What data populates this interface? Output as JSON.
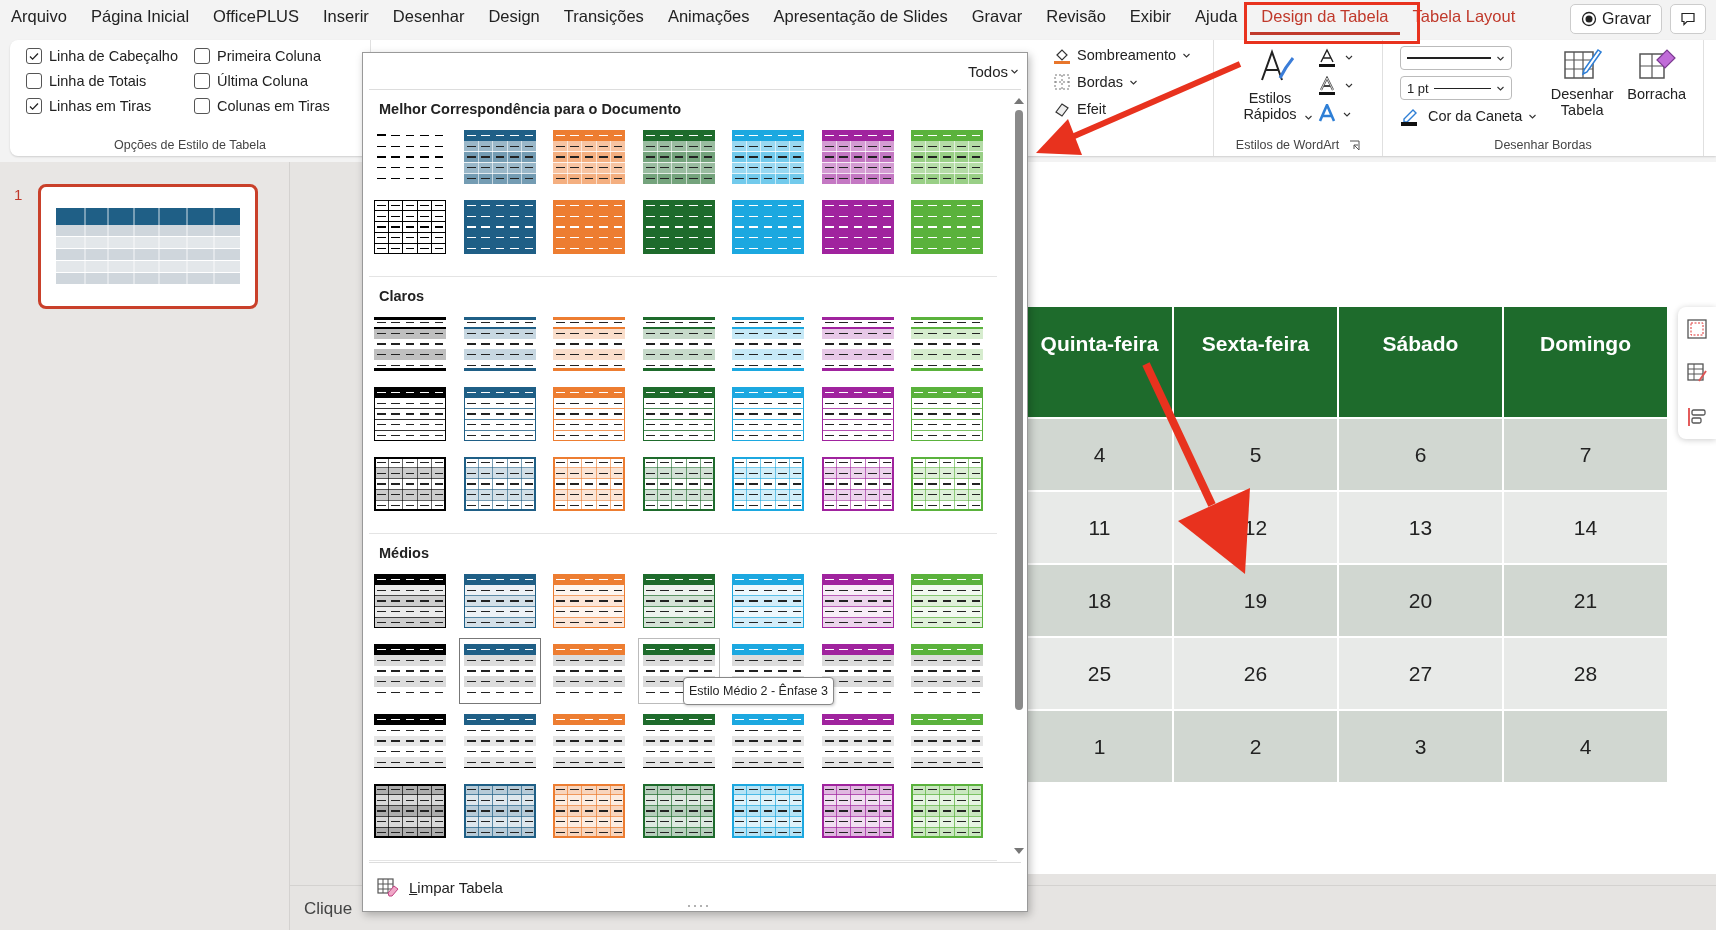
{
  "menu_tabs": [
    {
      "label": "Arquivo",
      "selected": false,
      "contextual": false
    },
    {
      "label": "Página Inicial",
      "selected": false,
      "contextual": false
    },
    {
      "label": "OfficePLUS",
      "selected": false,
      "contextual": false
    },
    {
      "label": "Inserir",
      "selected": false,
      "contextual": false
    },
    {
      "label": "Desenhar",
      "selected": false,
      "contextual": false
    },
    {
      "label": "Design",
      "selected": false,
      "contextual": false
    },
    {
      "label": "Transições",
      "selected": false,
      "contextual": false
    },
    {
      "label": "Animações",
      "selected": false,
      "contextual": false
    },
    {
      "label": "Apresentação de Slides",
      "selected": false,
      "contextual": false
    },
    {
      "label": "Gravar",
      "selected": false,
      "contextual": false
    },
    {
      "label": "Revisão",
      "selected": false,
      "contextual": false
    },
    {
      "label": "Exibir",
      "selected": false,
      "contextual": false
    },
    {
      "label": "Ajuda",
      "selected": false,
      "contextual": false
    },
    {
      "label": "Design da Tabela",
      "selected": true,
      "contextual": true
    },
    {
      "label": "Tabela Layout",
      "selected": false,
      "contextual": true
    }
  ],
  "record_button": "Gravar",
  "style_options": {
    "options": [
      {
        "label": "Linha de Cabeçalho",
        "checked": true
      },
      {
        "label": "Primeira Coluna",
        "checked": false
      },
      {
        "label": "Linha de Totais",
        "checked": false
      },
      {
        "label": "Última Coluna",
        "checked": false
      },
      {
        "label": "Linhas em Tiras",
        "checked": true
      },
      {
        "label": "Colunas em Tiras",
        "checked": false
      }
    ],
    "group_label": "Opções de Estilo de Tabela"
  },
  "fill_group": {
    "items": [
      {
        "kind": "shading",
        "label": "Sombreamento"
      },
      {
        "kind": "borders",
        "label": "Bordas"
      },
      {
        "kind": "effects",
        "label": "Efeit"
      }
    ]
  },
  "wordart_group": {
    "quick_styles": "Estilos Rápidos",
    "group_label": "Estilos de WordArt"
  },
  "draw_borders_group": {
    "pen_weight": "1 pt",
    "pen_color": "Cor da Caneta",
    "draw_table": "Desenhar Tabela",
    "eraser": "Borracha",
    "group_label": "Desenhar Bordas"
  },
  "slide_panel": {
    "slides": [
      {
        "number": "1",
        "selected": true
      }
    ]
  },
  "slide_table": {
    "columns": [
      "Quinta-feira",
      "Sexta-feira",
      "Sábado",
      "Domingo"
    ],
    "rows": [
      [
        "4",
        "5",
        "6",
        "7"
      ],
      [
        "11",
        "12",
        "13",
        "14"
      ],
      [
        "18",
        "19",
        "20",
        "21"
      ],
      [
        "25",
        "26",
        "27",
        "28"
      ],
      [
        "1",
        "2",
        "3",
        "4"
      ]
    ]
  },
  "notes": "Clique",
  "style_gallery": {
    "filter": "Todos",
    "clear_label": "Limpar Tabela",
    "tooltip": "Estilo Médio 2 - Ênfase 3",
    "sections": [
      {
        "title": "Melhor Correspondência para o Documento",
        "rows": [
          [
            {
              "kind": "none",
              "color": "#000000",
              "selected": false,
              "hovered": false
            },
            {
              "kind": "themed-grid",
              "color": "#1f5f86",
              "selected": false,
              "hovered": false
            },
            {
              "kind": "themed-grid",
              "color": "#ed7d31",
              "selected": false,
              "hovered": false
            },
            {
              "kind": "themed-grid",
              "color": "#1e6b2c",
              "selected": false,
              "hovered": false
            },
            {
              "kind": "themed-grid",
              "color": "#1ca8e0",
              "selected": false,
              "hovered": false
            },
            {
              "kind": "themed-grid",
              "color": "#a0239e",
              "selected": false,
              "hovered": false
            },
            {
              "kind": "themed-grid",
              "color": "#5ab23c",
              "selected": false,
              "hovered": false
            }
          ],
          [
            {
              "kind": "grid-plain",
              "color": "#000000",
              "selected": false,
              "hovered": false
            },
            {
              "kind": "themed-solid",
              "color": "#1f5f86",
              "selected": false,
              "hovered": false
            },
            {
              "kind": "themed-solid",
              "color": "#ed7d31",
              "selected": false,
              "hovered": false
            },
            {
              "kind": "themed-solid",
              "color": "#1e6b2c",
              "selected": false,
              "hovered": false
            },
            {
              "kind": "themed-solid",
              "color": "#1ca8e0",
              "selected": false,
              "hovered": false
            },
            {
              "kind": "themed-solid",
              "color": "#a0239e",
              "selected": false,
              "hovered": false
            },
            {
              "kind": "themed-solid",
              "color": "#5ab23c",
              "selected": false,
              "hovered": false
            }
          ]
        ]
      },
      {
        "title": "Claros",
        "rows": [
          [
            {
              "kind": "light-1",
              "color": "#000000",
              "selected": false,
              "hovered": false
            },
            {
              "kind": "light-1",
              "color": "#1f5f86",
              "selected": false,
              "hovered": false
            },
            {
              "kind": "light-1",
              "color": "#ed7d31",
              "selected": false,
              "hovered": false
            },
            {
              "kind": "light-1",
              "color": "#1e6b2c",
              "selected": false,
              "hovered": false
            },
            {
              "kind": "light-1",
              "color": "#1ca8e0",
              "selected": false,
              "hovered": false
            },
            {
              "kind": "light-1",
              "color": "#a0239e",
              "selected": false,
              "hovered": false
            },
            {
              "kind": "light-1",
              "color": "#5ab23c",
              "selected": false,
              "hovered": false
            }
          ],
          [
            {
              "kind": "light-2",
              "color": "#000000",
              "selected": false,
              "hovered": false
            },
            {
              "kind": "light-2",
              "color": "#1f5f86",
              "selected": false,
              "hovered": false
            },
            {
              "kind": "light-2",
              "color": "#ed7d31",
              "selected": false,
              "hovered": false
            },
            {
              "kind": "light-2",
              "color": "#1e6b2c",
              "selected": false,
              "hovered": false
            },
            {
              "kind": "light-2",
              "color": "#1ca8e0",
              "selected": false,
              "hovered": false
            },
            {
              "kind": "light-2",
              "color": "#a0239e",
              "selected": false,
              "hovered": false
            },
            {
              "kind": "light-2",
              "color": "#5ab23c",
              "selected": false,
              "hovered": false
            }
          ],
          [
            {
              "kind": "light-3",
              "color": "#000000",
              "selected": false,
              "hovered": false
            },
            {
              "kind": "light-3",
              "color": "#1f5f86",
              "selected": false,
              "hovered": false
            },
            {
              "kind": "light-3",
              "color": "#ed7d31",
              "selected": false,
              "hovered": false
            },
            {
              "kind": "light-3",
              "color": "#1e6b2c",
              "selected": false,
              "hovered": false
            },
            {
              "kind": "light-3",
              "color": "#1ca8e0",
              "selected": false,
              "hovered": false
            },
            {
              "kind": "light-3",
              "color": "#a0239e",
              "selected": false,
              "hovered": false
            },
            {
              "kind": "light-3",
              "color": "#5ab23c",
              "selected": false,
              "hovered": false
            }
          ]
        ]
      },
      {
        "title": "Médios",
        "rows": [
          [
            {
              "kind": "medium-1",
              "color": "#000000",
              "selected": false,
              "hovered": false
            },
            {
              "kind": "medium-1",
              "color": "#1f5f86",
              "selected": false,
              "hovered": false
            },
            {
              "kind": "medium-1",
              "color": "#ed7d31",
              "selected": false,
              "hovered": false
            },
            {
              "kind": "medium-1",
              "color": "#1e6b2c",
              "selected": false,
              "hovered": false
            },
            {
              "kind": "medium-1",
              "color": "#1ca8e0",
              "selected": false,
              "hovered": false
            },
            {
              "kind": "medium-1",
              "color": "#a0239e",
              "selected": false,
              "hovered": false
            },
            {
              "kind": "medium-1",
              "color": "#5ab23c",
              "selected": false,
              "hovered": false
            }
          ],
          [
            {
              "kind": "medium-2",
              "color": "#000000",
              "selected": false,
              "hovered": false
            },
            {
              "kind": "medium-2",
              "color": "#1f5f86",
              "selected": true,
              "hovered": false
            },
            {
              "kind": "medium-2",
              "color": "#ed7d31",
              "selected": false,
              "hovered": false
            },
            {
              "kind": "medium-2",
              "color": "#1e6b2c",
              "selected": false,
              "hovered": true
            },
            {
              "kind": "medium-2",
              "color": "#1ca8e0",
              "selected": false,
              "hovered": false
            },
            {
              "kind": "medium-2",
              "color": "#a0239e",
              "selected": false,
              "hovered": false
            },
            {
              "kind": "medium-2",
              "color": "#5ab23c",
              "selected": false,
              "hovered": false
            }
          ],
          [
            {
              "kind": "medium-3",
              "color": "#000000",
              "selected": false,
              "hovered": false
            },
            {
              "kind": "medium-3",
              "color": "#1f5f86",
              "selected": false,
              "hovered": false
            },
            {
              "kind": "medium-3",
              "color": "#ed7d31",
              "selected": false,
              "hovered": false
            },
            {
              "kind": "medium-3",
              "color": "#1e6b2c",
              "selected": false,
              "hovered": false
            },
            {
              "kind": "medium-3",
              "color": "#1ca8e0",
              "selected": false,
              "hovered": false
            },
            {
              "kind": "medium-3",
              "color": "#a0239e",
              "selected": false,
              "hovered": false
            },
            {
              "kind": "medium-3",
              "color": "#5ab23c",
              "selected": false,
              "hovered": false
            }
          ],
          [
            {
              "kind": "medium-4",
              "color": "#000000",
              "selected": false,
              "hovered": false
            },
            {
              "kind": "medium-4",
              "color": "#1f5f86",
              "selected": false,
              "hovered": false
            },
            {
              "kind": "medium-4",
              "color": "#ed7d31",
              "selected": false,
              "hovered": false
            },
            {
              "kind": "medium-4",
              "color": "#1e6b2c",
              "selected": false,
              "hovered": false
            },
            {
              "kind": "medium-4",
              "color": "#1ca8e0",
              "selected": false,
              "hovered": false
            },
            {
              "kind": "medium-4",
              "color": "#a0239e",
              "selected": false,
              "hovered": false
            },
            {
              "kind": "medium-4",
              "color": "#5ab23c",
              "selected": false,
              "hovered": false
            }
          ]
        ]
      }
    ]
  }
}
